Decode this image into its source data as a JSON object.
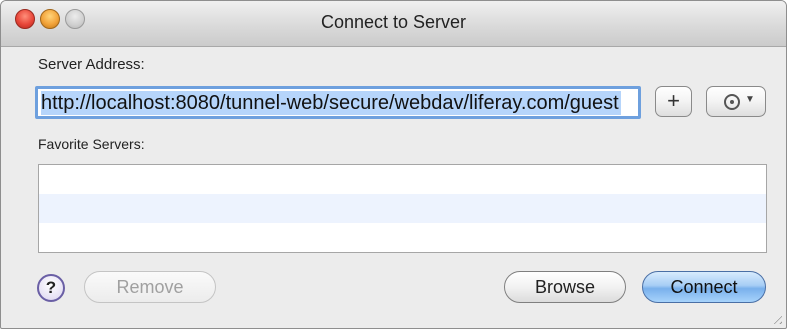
{
  "window": {
    "title": "Connect to Server"
  },
  "server_address": {
    "label": "Server Address:",
    "value": "http://localhost:8080/tunnel-web/secure/webdav/liferay.com/guest"
  },
  "buttons": {
    "add_label": "+",
    "remove_label": "Remove",
    "browse_label": "Browse",
    "connect_label": "Connect",
    "help_label": "?"
  },
  "favorites": {
    "label": "Favorite Servers:",
    "items": []
  },
  "icons": {
    "close": "close-icon",
    "minimize": "minimize-icon",
    "zoom": "zoom-icon",
    "action": "gear-icon",
    "dropdown": "chevron-down-icon",
    "resize": "resize-grip-icon"
  },
  "colors": {
    "focus_ring": "#6ea0de",
    "selection": "#b6d5fb",
    "default_button": "#79b0ec",
    "help_ring": "#6a5fa5",
    "list_stripe": "#edf3fe"
  }
}
